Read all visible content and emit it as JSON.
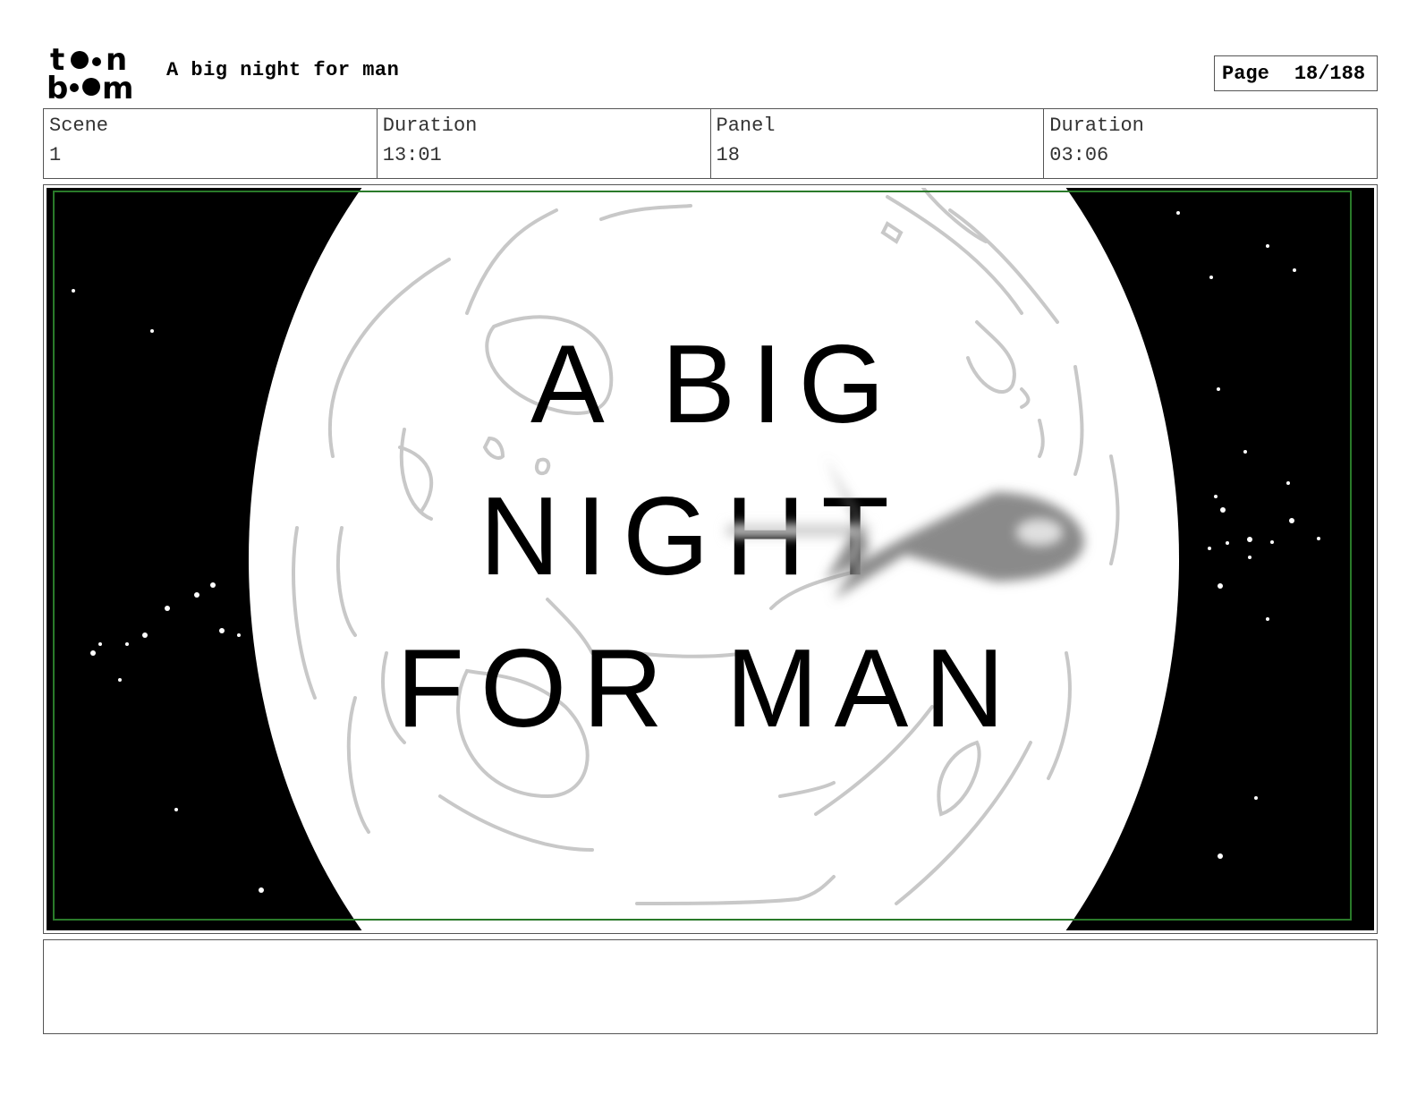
{
  "header": {
    "logo_text": "toon boom",
    "title": "A big night for man",
    "page_label": "Page",
    "page_value": "18/188"
  },
  "info": {
    "scene_label": "Scene",
    "scene_value": "1",
    "duration_label": "Duration",
    "duration_value": "13:01",
    "panel_label": "Panel",
    "panel_value": "18",
    "panel_duration_label": "Duration",
    "panel_duration_value": "03:06"
  },
  "panel": {
    "title_lines": [
      "A BIG",
      "NIGHT",
      "FOR MAN"
    ],
    "colors": {
      "space": "#000000",
      "moon": "#ffffff",
      "craters": "#c8c8c8",
      "frame_guide": "#2a7a2a",
      "rocket": "#8a8a8a"
    }
  },
  "notes": {
    "text": ""
  }
}
